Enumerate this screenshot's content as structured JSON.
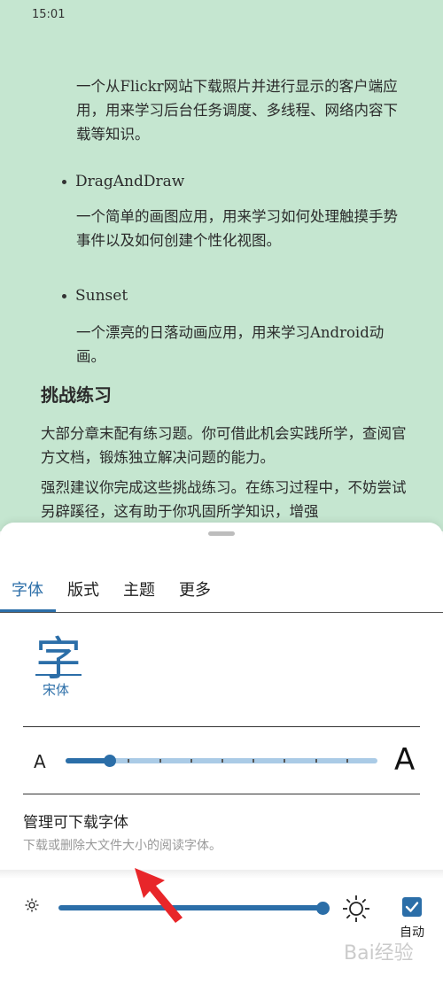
{
  "status": {
    "time": "15:01"
  },
  "reader": {
    "para1": "一个从Flickr网站下载照片并进行显示的客户端应用，用来学习后台任务调度、多线程、网络内容下载等知识。",
    "item2_title": "DragAndDraw",
    "item2_desc": "一个简单的画图应用，用来学习如何处理触摸手势事件以及如何创建个性化视图。",
    "item3_title": "Sunset",
    "item3_desc": "一个漂亮的日落动画应用，用来学习Android动画。",
    "heading": "挑战练习",
    "para2": "大部分章末配有练习题。你可借此机会实践所学，查阅官方文档，锻炼独立解决问题的能力。",
    "para3": "强烈建议你完成这些挑战练习。在练习过程中，不妨尝试另辟蹊径，这有助于你巩固所学知识，增强"
  },
  "tabs": [
    {
      "label": "字体",
      "active": true
    },
    {
      "label": "版式",
      "active": false
    },
    {
      "label": "主题",
      "active": false
    },
    {
      "label": "更多",
      "active": false
    }
  ],
  "font": {
    "glyph": "字",
    "name": "宋体"
  },
  "size_slider": {
    "small_label": "A",
    "large_label": "A",
    "steps": 10,
    "value_step": 1
  },
  "manage": {
    "title": "管理可下载字体",
    "subtitle": "下载或删除大文件大小的阅读字体。"
  },
  "brightness": {
    "value": 1.0,
    "auto_label": "自动",
    "auto_checked": true
  },
  "colors": {
    "accent": "#2b6ea8",
    "reader_bg": "#c5e6d0",
    "annotation_arrow": "#e8262a"
  },
  "watermark": {
    "text": "Bai经验"
  }
}
